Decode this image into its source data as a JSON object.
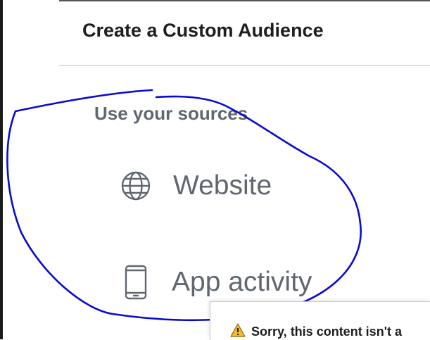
{
  "dialog": {
    "title": "Create a Custom Audience",
    "section_heading": "Use your sources"
  },
  "sources": [
    {
      "label": "Website",
      "icon": "globe-icon"
    },
    {
      "label": "App activity",
      "icon": "mobile-phone-icon"
    }
  ],
  "banner": {
    "message": "Sorry, this content isn't a",
    "icon": "warning-icon"
  },
  "colors": {
    "title_text": "#1c1e21",
    "muted_text": "#606770",
    "divider": "#dddfe2",
    "annotation_stroke": "#0a0ad0",
    "warning_fill": "#f7b928"
  }
}
